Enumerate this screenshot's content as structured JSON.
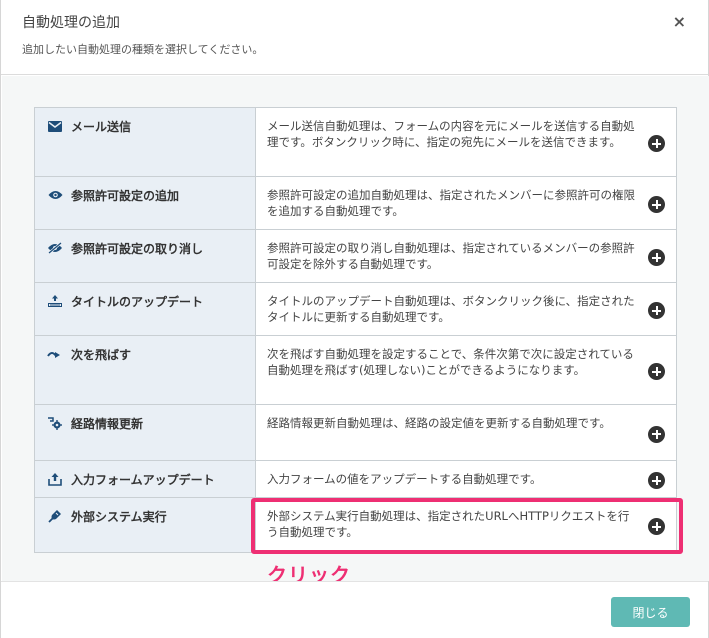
{
  "dialog": {
    "title": "自動処理の追加",
    "subtitle": "追加したい自動処理の種類を選択してください。",
    "close_icon": "×"
  },
  "actions": [
    {
      "icon": "envelope-icon",
      "name": "メール送信",
      "description": "メール送信自動処理は、フォームの内容を元にメールを送信する自動処理です。ボタンクリック時に、指定の宛先にメールを送信できます。"
    },
    {
      "icon": "eye-icon",
      "name": "参照許可設定の追加",
      "description": "参照許可設定の追加自動処理は、指定されたメンバーに参照許可の権限を追加する自動処理です。"
    },
    {
      "icon": "eye-slash-icon",
      "name": "参照許可設定の取り消し",
      "description": "参照許可設定の取り消し自動処理は、指定されているメンバーの参照許可設定を除外する自動処理です。"
    },
    {
      "icon": "title-update-icon",
      "name": "タイトルのアップデート",
      "description": "タイトルのアップデート自動処理は、ボタンクリック後に、指定されたタイトルに更新する自動処理です。"
    },
    {
      "icon": "skip-arrow-icon",
      "name": "次を飛ばす",
      "description": "次を飛ばす自動処理を設定することで、条件次第で次に設定されている自動処理を飛ばす(処理しない)ことができるようになります。"
    },
    {
      "icon": "route-gear-icon",
      "name": "経路情報更新",
      "description": "経路情報更新自動処理は、経路の設定値を更新する自動処理です。"
    },
    {
      "icon": "upload-icon",
      "name": "入力フォームアップデート",
      "description": "入力フォームの値をアップデートする自動処理です。"
    },
    {
      "icon": "plug-icon",
      "name": "外部システム実行",
      "description": "外部システム実行自動処理は、指定されたURLへHTTPリクエストを行う自動処理です。"
    }
  ],
  "annotation": {
    "click_label": "クリック",
    "highlight_color": "#ee2f73"
  },
  "footer": {
    "close_label": "閉じる"
  },
  "colors": {
    "accent": "#5fb9b4",
    "name_cell_bg": "#e9eff5",
    "icon_color": "#1e4d79"
  }
}
